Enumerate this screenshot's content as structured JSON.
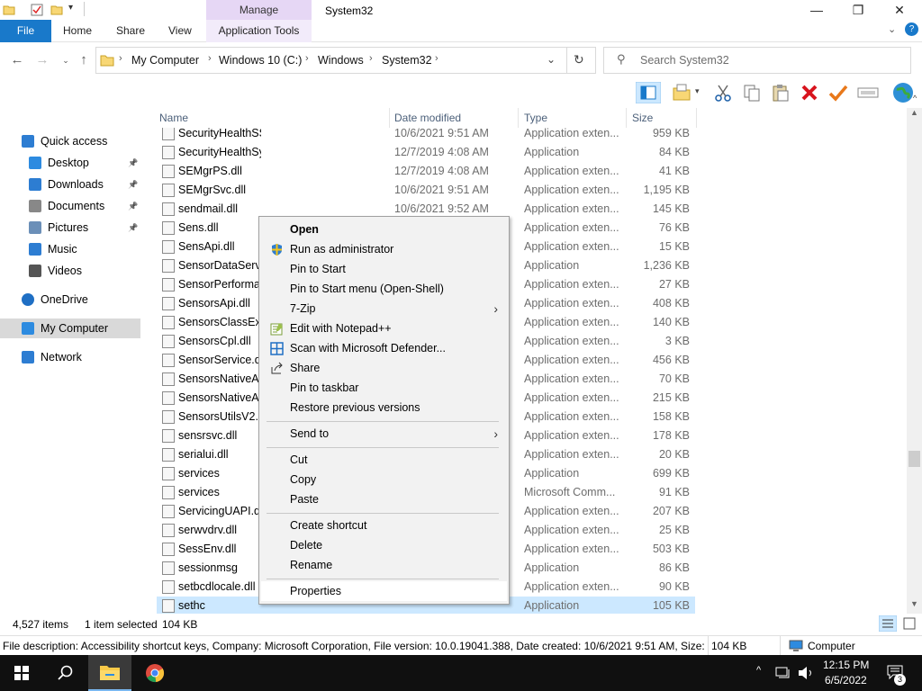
{
  "window": {
    "title": "System32",
    "manage_label": "Manage",
    "app_tools_label": "Application Tools",
    "minimize": "—",
    "maximize": "❐",
    "close": "✕",
    "help": "?"
  },
  "ribbon": {
    "file": "File",
    "home": "Home",
    "share": "Share",
    "view": "View"
  },
  "address": {
    "crumbs": [
      "My Computer",
      "Windows 10 (C:)",
      "Windows",
      "System32"
    ],
    "search_placeholder": "Search System32"
  },
  "nav": {
    "items": [
      {
        "label": "Quick access",
        "icon": "star-icon",
        "pinned": false
      },
      {
        "label": "Desktop",
        "icon": "desktop-icon",
        "pinned": true
      },
      {
        "label": "Downloads",
        "icon": "download-icon",
        "pinned": true
      },
      {
        "label": "Documents",
        "icon": "document-icon",
        "pinned": true
      },
      {
        "label": "Pictures",
        "icon": "pictures-icon",
        "pinned": true
      },
      {
        "label": "Music",
        "icon": "music-icon",
        "pinned": false
      },
      {
        "label": "Videos",
        "icon": "video-icon",
        "pinned": false
      },
      {
        "label": "OneDrive",
        "icon": "cloud-icon",
        "pinned": false
      },
      {
        "label": "My Computer",
        "icon": "computer-icon",
        "pinned": false
      },
      {
        "label": "Network",
        "icon": "network-icon",
        "pinned": false
      }
    ]
  },
  "columns": {
    "name": "Name",
    "date": "Date modified",
    "type": "Type",
    "size": "Size"
  },
  "files": [
    {
      "name": "SecurityHealthSSO.dll",
      "date": "10/6/2021 9:51 AM",
      "type": "Application exten...",
      "size": "959 KB"
    },
    {
      "name": "SecurityHealthSystray",
      "date": "12/7/2019 4:08 AM",
      "type": "Application",
      "size": "84 KB"
    },
    {
      "name": "SEMgrPS.dll",
      "date": "12/7/2019 4:08 AM",
      "type": "Application exten...",
      "size": "41 KB"
    },
    {
      "name": "SEMgrSvc.dll",
      "date": "10/6/2021 9:51 AM",
      "type": "Application exten...",
      "size": "1,195 KB"
    },
    {
      "name": "sendmail.dll",
      "date": "10/6/2021 9:52 AM",
      "type": "Application exten...",
      "size": "145 KB"
    },
    {
      "name": "Sens.dll",
      "date": "",
      "type": "Application exten...",
      "size": "76 KB"
    },
    {
      "name": "SensApi.dll",
      "date": "",
      "type": "Application exten...",
      "size": "15 KB"
    },
    {
      "name": "SensorDataService",
      "date": "",
      "type": "Application",
      "size": "1,236 KB"
    },
    {
      "name": "SensorPerformance",
      "date": "",
      "type": "Application exten...",
      "size": "27 KB"
    },
    {
      "name": "SensorsApi.dll",
      "date": "",
      "type": "Application exten...",
      "size": "408 KB"
    },
    {
      "name": "SensorsClassExte",
      "date": "",
      "type": "Application exten...",
      "size": "140 KB"
    },
    {
      "name": "SensorsCpl.dll",
      "date": "",
      "type": "Application exten...",
      "size": "3 KB"
    },
    {
      "name": "SensorService.dll",
      "date": "",
      "type": "Application exten...",
      "size": "456 KB"
    },
    {
      "name": "SensorsNativeAp",
      "date": "",
      "type": "Application exten...",
      "size": "70 KB"
    },
    {
      "name": "SensorsNativeAp",
      "date": "",
      "type": "Application exten...",
      "size": "215 KB"
    },
    {
      "name": "SensorsUtilsV2.dll",
      "date": "",
      "type": "Application exten...",
      "size": "158 KB"
    },
    {
      "name": "sensrsvc.dll",
      "date": "",
      "type": "Application exten...",
      "size": "178 KB"
    },
    {
      "name": "serialui.dll",
      "date": "",
      "type": "Application exten...",
      "size": "20 KB"
    },
    {
      "name": "services",
      "date": "",
      "type": "Application",
      "size": "699 KB"
    },
    {
      "name": "services",
      "date": "",
      "type": "Microsoft Comm...",
      "size": "91 KB"
    },
    {
      "name": "ServicingUAPI.dll",
      "date": "",
      "type": "Application exten...",
      "size": "207 KB"
    },
    {
      "name": "serwvdrv.dll",
      "date": "",
      "type": "Application exten...",
      "size": "25 KB"
    },
    {
      "name": "SessEnv.dll",
      "date": "",
      "type": "Application exten...",
      "size": "503 KB"
    },
    {
      "name": "sessionmsg",
      "date": "",
      "type": "Application",
      "size": "86 KB"
    },
    {
      "name": "setbcdlocale.dll",
      "date": "",
      "type": "Application exten...",
      "size": "90 KB"
    },
    {
      "name": "sethc",
      "date": "",
      "type": "Application",
      "size": "105 KB"
    }
  ],
  "context_menu": {
    "open": "Open",
    "run_admin": "Run as administrator",
    "pin_start": "Pin to Start",
    "pin_start_menu": "Pin to Start menu (Open-Shell)",
    "seven_zip": "7-Zip",
    "edit_npp": "Edit with Notepad++",
    "scan_defender": "Scan with Microsoft Defender...",
    "share": "Share",
    "pin_taskbar": "Pin to taskbar",
    "restore_versions": "Restore previous versions",
    "send_to": "Send to",
    "cut": "Cut",
    "copy": "Copy",
    "paste": "Paste",
    "create_shortcut": "Create shortcut",
    "delete": "Delete",
    "rename": "Rename",
    "properties": "Properties"
  },
  "status": {
    "items_count": "4,527 items",
    "selected": "1 item selected",
    "selected_size": "104 KB",
    "description": "File description: Accessibility shortcut keys, Company: Microsoft Corporation, File version: 10.0.19041.388, Date created: 10/6/2021 9:51 AM, Size: 104",
    "size": "104 KB",
    "location": "Computer"
  },
  "taskbar": {
    "time": "12:15 PM",
    "date": "6/5/2022",
    "notifications": "3"
  },
  "colors": {
    "file_tab": "#1979ca",
    "manage_tab": "#e6d7f5",
    "selection": "#cce8ff",
    "taskbar": "#101010"
  }
}
